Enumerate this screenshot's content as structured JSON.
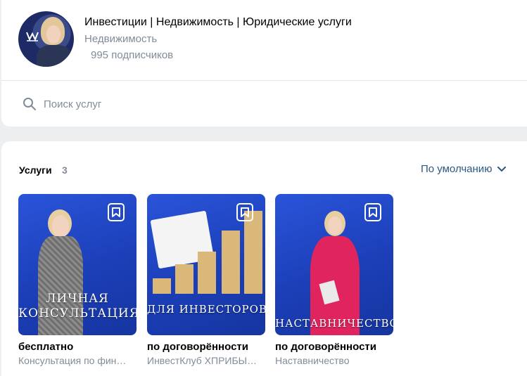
{
  "header": {
    "title": "Инвестиции | Недвижимость | Юридические услуги",
    "category": "Недвижимость",
    "subscribers": "995 подписчиков"
  },
  "search": {
    "placeholder": "Поиск услуг"
  },
  "services": {
    "title": "Услуги",
    "count": "3",
    "sort_label": "По умолчанию",
    "items": [
      {
        "overlay": "ЛИЧНАЯ\nКОНСУЛЬТАЦИЯ",
        "price": "бесплатно",
        "description": "Консультация по фин…"
      },
      {
        "overlay": "ДЛЯ ИНВЕСТОРОВ",
        "price": "по договорённости",
        "description": "ИнвестКлуб ХПРИБЫ…"
      },
      {
        "overlay": "НАСТАВНИЧЕСТВО",
        "price": "по договорённости",
        "description": "Наставничество"
      }
    ]
  },
  "colors": {
    "link": "#2a5885",
    "secondary_text": "#818c99",
    "tile_blue": "#1c3fb8"
  }
}
